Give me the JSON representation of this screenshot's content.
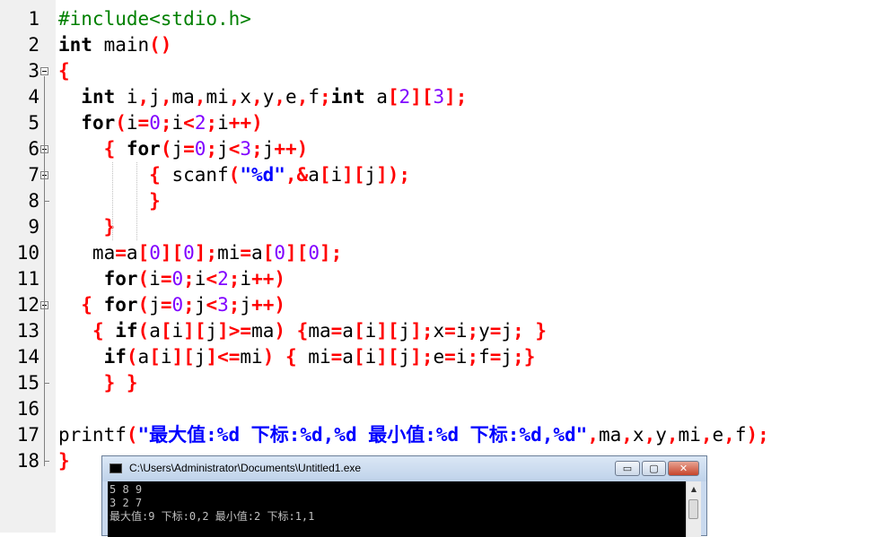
{
  "editor": {
    "line_numbers": [
      "1",
      "2",
      "3",
      "4",
      "5",
      "6",
      "7",
      "8",
      "9",
      "10",
      "11",
      "12",
      "13",
      "14",
      "15",
      "16",
      "17",
      "18"
    ],
    "lines": [
      [
        {
          "t": "pp",
          "s": "#include<stdio.h>"
        }
      ],
      [
        {
          "t": "kw",
          "s": "int"
        },
        {
          "t": "p",
          "s": " main"
        },
        {
          "t": "sym",
          "s": "()"
        }
      ],
      [
        {
          "t": "sym",
          "s": "{"
        }
      ],
      [
        {
          "t": "p",
          "s": "  "
        },
        {
          "t": "kw",
          "s": "int"
        },
        {
          "t": "p",
          "s": " i"
        },
        {
          "t": "sym",
          "s": ","
        },
        {
          "t": "p",
          "s": "j"
        },
        {
          "t": "sym",
          "s": ","
        },
        {
          "t": "p",
          "s": "ma"
        },
        {
          "t": "sym",
          "s": ","
        },
        {
          "t": "p",
          "s": "mi"
        },
        {
          "t": "sym",
          "s": ","
        },
        {
          "t": "p",
          "s": "x"
        },
        {
          "t": "sym",
          "s": ","
        },
        {
          "t": "p",
          "s": "y"
        },
        {
          "t": "sym",
          "s": ","
        },
        {
          "t": "p",
          "s": "e"
        },
        {
          "t": "sym",
          "s": ","
        },
        {
          "t": "p",
          "s": "f"
        },
        {
          "t": "sym",
          "s": ";"
        },
        {
          "t": "kw",
          "s": "int"
        },
        {
          "t": "p",
          "s": " a"
        },
        {
          "t": "sym",
          "s": "["
        },
        {
          "t": "num",
          "s": "2"
        },
        {
          "t": "sym",
          "s": "]["
        },
        {
          "t": "num",
          "s": "3"
        },
        {
          "t": "sym",
          "s": "];"
        }
      ],
      [
        {
          "t": "p",
          "s": "  "
        },
        {
          "t": "kw",
          "s": "for"
        },
        {
          "t": "sym",
          "s": "("
        },
        {
          "t": "p",
          "s": "i"
        },
        {
          "t": "sym",
          "s": "="
        },
        {
          "t": "num",
          "s": "0"
        },
        {
          "t": "sym",
          "s": ";"
        },
        {
          "t": "p",
          "s": "i"
        },
        {
          "t": "sym",
          "s": "<"
        },
        {
          "t": "num",
          "s": "2"
        },
        {
          "t": "sym",
          "s": ";"
        },
        {
          "t": "p",
          "s": "i"
        },
        {
          "t": "sym",
          "s": "++)"
        }
      ],
      [
        {
          "t": "p",
          "s": "    "
        },
        {
          "t": "sym",
          "s": "{"
        },
        {
          "t": "p",
          "s": " "
        },
        {
          "t": "kw",
          "s": "for"
        },
        {
          "t": "sym",
          "s": "("
        },
        {
          "t": "p",
          "s": "j"
        },
        {
          "t": "sym",
          "s": "="
        },
        {
          "t": "num",
          "s": "0"
        },
        {
          "t": "sym",
          "s": ";"
        },
        {
          "t": "p",
          "s": "j"
        },
        {
          "t": "sym",
          "s": "<"
        },
        {
          "t": "num",
          "s": "3"
        },
        {
          "t": "sym",
          "s": ";"
        },
        {
          "t": "p",
          "s": "j"
        },
        {
          "t": "sym",
          "s": "++)"
        }
      ],
      [
        {
          "t": "p",
          "s": "        "
        },
        {
          "t": "sym",
          "s": "{"
        },
        {
          "t": "p",
          "s": " scanf"
        },
        {
          "t": "sym",
          "s": "("
        },
        {
          "t": "str",
          "s": "\"%d\""
        },
        {
          "t": "sym",
          "s": ",&"
        },
        {
          "t": "p",
          "s": "a"
        },
        {
          "t": "sym",
          "s": "["
        },
        {
          "t": "p",
          "s": "i"
        },
        {
          "t": "sym",
          "s": "]["
        },
        {
          "t": "p",
          "s": "j"
        },
        {
          "t": "sym",
          "s": "]);"
        }
      ],
      [
        {
          "t": "p",
          "s": "        "
        },
        {
          "t": "sym",
          "s": "}"
        }
      ],
      [
        {
          "t": "p",
          "s": "    "
        },
        {
          "t": "sym",
          "s": "}"
        }
      ],
      [
        {
          "t": "p",
          "s": "   ma"
        },
        {
          "t": "sym",
          "s": "="
        },
        {
          "t": "p",
          "s": "a"
        },
        {
          "t": "sym",
          "s": "["
        },
        {
          "t": "num",
          "s": "0"
        },
        {
          "t": "sym",
          "s": "]["
        },
        {
          "t": "num",
          "s": "0"
        },
        {
          "t": "sym",
          "s": "];"
        },
        {
          "t": "p",
          "s": "mi"
        },
        {
          "t": "sym",
          "s": "="
        },
        {
          "t": "p",
          "s": "a"
        },
        {
          "t": "sym",
          "s": "["
        },
        {
          "t": "num",
          "s": "0"
        },
        {
          "t": "sym",
          "s": "]["
        },
        {
          "t": "num",
          "s": "0"
        },
        {
          "t": "sym",
          "s": "];"
        }
      ],
      [
        {
          "t": "p",
          "s": "    "
        },
        {
          "t": "kw",
          "s": "for"
        },
        {
          "t": "sym",
          "s": "("
        },
        {
          "t": "p",
          "s": "i"
        },
        {
          "t": "sym",
          "s": "="
        },
        {
          "t": "num",
          "s": "0"
        },
        {
          "t": "sym",
          "s": ";"
        },
        {
          "t": "p",
          "s": "i"
        },
        {
          "t": "sym",
          "s": "<"
        },
        {
          "t": "num",
          "s": "2"
        },
        {
          "t": "sym",
          "s": ";"
        },
        {
          "t": "p",
          "s": "i"
        },
        {
          "t": "sym",
          "s": "++)"
        }
      ],
      [
        {
          "t": "p",
          "s": "  "
        },
        {
          "t": "sym",
          "s": "{"
        },
        {
          "t": "p",
          "s": " "
        },
        {
          "t": "kw",
          "s": "for"
        },
        {
          "t": "sym",
          "s": "("
        },
        {
          "t": "p",
          "s": "j"
        },
        {
          "t": "sym",
          "s": "="
        },
        {
          "t": "num",
          "s": "0"
        },
        {
          "t": "sym",
          "s": ";"
        },
        {
          "t": "p",
          "s": "j"
        },
        {
          "t": "sym",
          "s": "<"
        },
        {
          "t": "num",
          "s": "3"
        },
        {
          "t": "sym",
          "s": ";"
        },
        {
          "t": "p",
          "s": "j"
        },
        {
          "t": "sym",
          "s": "++)"
        }
      ],
      [
        {
          "t": "p",
          "s": "   "
        },
        {
          "t": "sym",
          "s": "{"
        },
        {
          "t": "p",
          "s": " "
        },
        {
          "t": "kw",
          "s": "if"
        },
        {
          "t": "sym",
          "s": "("
        },
        {
          "t": "p",
          "s": "a"
        },
        {
          "t": "sym",
          "s": "["
        },
        {
          "t": "p",
          "s": "i"
        },
        {
          "t": "sym",
          "s": "]["
        },
        {
          "t": "p",
          "s": "j"
        },
        {
          "t": "sym",
          "s": "]>="
        },
        {
          "t": "p",
          "s": "ma"
        },
        {
          "t": "sym",
          "s": ")"
        },
        {
          "t": "p",
          "s": " "
        },
        {
          "t": "sym",
          "s": "{"
        },
        {
          "t": "p",
          "s": "ma"
        },
        {
          "t": "sym",
          "s": "="
        },
        {
          "t": "p",
          "s": "a"
        },
        {
          "t": "sym",
          "s": "["
        },
        {
          "t": "p",
          "s": "i"
        },
        {
          "t": "sym",
          "s": "]["
        },
        {
          "t": "p",
          "s": "j"
        },
        {
          "t": "sym",
          "s": "];"
        },
        {
          "t": "p",
          "s": "x"
        },
        {
          "t": "sym",
          "s": "="
        },
        {
          "t": "p",
          "s": "i"
        },
        {
          "t": "sym",
          "s": ";"
        },
        {
          "t": "p",
          "s": "y"
        },
        {
          "t": "sym",
          "s": "="
        },
        {
          "t": "p",
          "s": "j"
        },
        {
          "t": "sym",
          "s": ";"
        },
        {
          "t": "p",
          "s": " "
        },
        {
          "t": "sym",
          "s": "}"
        }
      ],
      [
        {
          "t": "p",
          "s": "    "
        },
        {
          "t": "kw",
          "s": "if"
        },
        {
          "t": "sym",
          "s": "("
        },
        {
          "t": "p",
          "s": "a"
        },
        {
          "t": "sym",
          "s": "["
        },
        {
          "t": "p",
          "s": "i"
        },
        {
          "t": "sym",
          "s": "]["
        },
        {
          "t": "p",
          "s": "j"
        },
        {
          "t": "sym",
          "s": "]<="
        },
        {
          "t": "p",
          "s": "mi"
        },
        {
          "t": "sym",
          "s": ")"
        },
        {
          "t": "p",
          "s": " "
        },
        {
          "t": "sym",
          "s": "{"
        },
        {
          "t": "p",
          "s": " mi"
        },
        {
          "t": "sym",
          "s": "="
        },
        {
          "t": "p",
          "s": "a"
        },
        {
          "t": "sym",
          "s": "["
        },
        {
          "t": "p",
          "s": "i"
        },
        {
          "t": "sym",
          "s": "]["
        },
        {
          "t": "p",
          "s": "j"
        },
        {
          "t": "sym",
          "s": "];"
        },
        {
          "t": "p",
          "s": "e"
        },
        {
          "t": "sym",
          "s": "="
        },
        {
          "t": "p",
          "s": "i"
        },
        {
          "t": "sym",
          "s": ";"
        },
        {
          "t": "p",
          "s": "f"
        },
        {
          "t": "sym",
          "s": "="
        },
        {
          "t": "p",
          "s": "j"
        },
        {
          "t": "sym",
          "s": ";}"
        }
      ],
      [
        {
          "t": "p",
          "s": "    "
        },
        {
          "t": "sym",
          "s": "}"
        },
        {
          "t": "p",
          "s": " "
        },
        {
          "t": "sym",
          "s": "}"
        }
      ],
      [
        {
          "t": "p",
          "s": ""
        }
      ],
      [
        {
          "t": "p",
          "s": "printf"
        },
        {
          "t": "sym",
          "s": "("
        },
        {
          "t": "str",
          "s": "\"最大值:%d 下标:%d,%d 最小值:%d 下标:%d,%d\""
        },
        {
          "t": "sym",
          "s": ","
        },
        {
          "t": "p",
          "s": "ma"
        },
        {
          "t": "sym",
          "s": ","
        },
        {
          "t": "p",
          "s": "x"
        },
        {
          "t": "sym",
          "s": ","
        },
        {
          "t": "p",
          "s": "y"
        },
        {
          "t": "sym",
          "s": ","
        },
        {
          "t": "p",
          "s": "mi"
        },
        {
          "t": "sym",
          "s": ","
        },
        {
          "t": "p",
          "s": "e"
        },
        {
          "t": "sym",
          "s": ","
        },
        {
          "t": "p",
          "s": "f"
        },
        {
          "t": "sym",
          "s": ");"
        }
      ],
      [
        {
          "t": "sym",
          "s": "}"
        }
      ]
    ],
    "colors": {
      "keyword": "#000000",
      "preprocessor": "#008000",
      "number": "#8000ff",
      "symbol": "#ff0000",
      "string": "#0000ff",
      "gutter": "#f0f0f0"
    }
  },
  "console": {
    "title": "C:\\Users\\Administrator\\Documents\\Untitled1.exe",
    "minimize_label": "▭",
    "maximize_label": "▢",
    "close_label": "✕",
    "scroll_up_label": "▲",
    "output": [
      "5 8 9",
      "3 2 7",
      "最大值:9 下标:0,2 最小值:2 下标:1,1"
    ]
  }
}
